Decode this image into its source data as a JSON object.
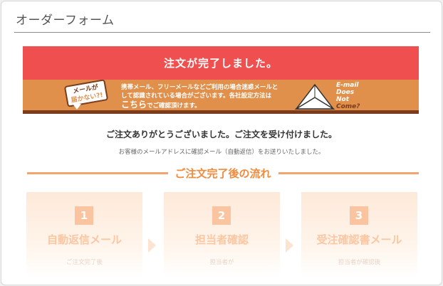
{
  "page": {
    "title": "オーダーフォーム"
  },
  "complete_banner": {
    "text": "注文が完了しました。"
  },
  "mail_notice": {
    "bubble_line1": "メールが",
    "bubble_line2": "届かない?!",
    "line1": "携帯メール、フリーメールなどご利用の場合迷惑メールと",
    "line2": "して認識されている場合がございます。各社設定方法は",
    "link_text": "こちら",
    "line3_rest": "でご確認頂けます。",
    "email_label": [
      "E-mail",
      "Does",
      "Not",
      "Come?"
    ],
    "icon": "envelope-icon"
  },
  "thanks": "ご注文ありがとうございました。ご注文を受け付けました。",
  "sub_message": "お客様のメールアドレスに確認メール（自動返信）をお送りいたしました。",
  "flow": {
    "heading": "ご注文完了後の流れ",
    "steps": [
      {
        "num": "1",
        "name": "自動返信メール",
        "desc": "ご注文完了後"
      },
      {
        "num": "2",
        "name": "担当者確認",
        "desc": "担当者が"
      },
      {
        "num": "3",
        "name": "受注確認書メール",
        "desc": "担当者が確認後"
      }
    ]
  },
  "colors": {
    "red": "#ef4f4f",
    "orange": "#e0904a",
    "accent": "#f08a3c"
  }
}
